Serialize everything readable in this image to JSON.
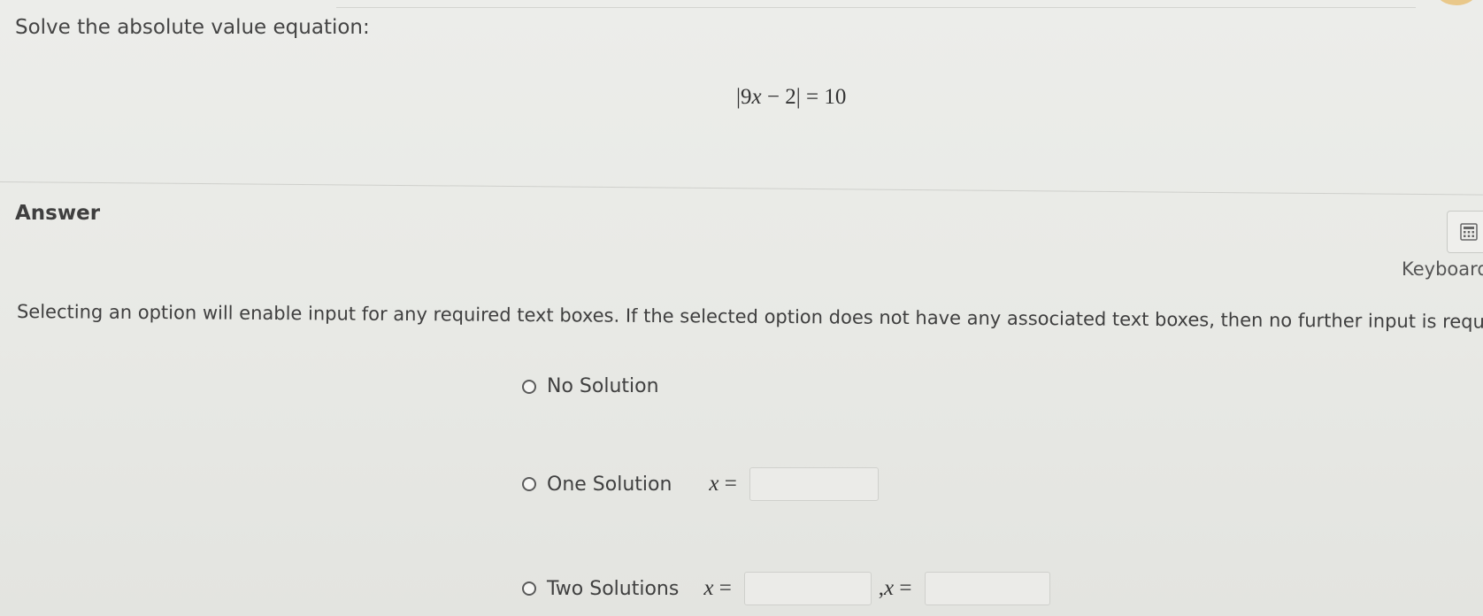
{
  "prompt": "Solve the absolute value equation:",
  "equation": {
    "bar_open": "|",
    "coef": "9",
    "variable": "x",
    "minus": " − 2",
    "bar_close": "|",
    "equals": " = ",
    "rhs": "10"
  },
  "answer_heading": "Answer",
  "keyboard": {
    "icon": "calculator-icon",
    "label": "Keyboard"
  },
  "instructions": "Selecting an option will enable input for any required text boxes. If the selected option does not have any associated text boxes, then no further input is required.",
  "options": [
    {
      "label": "No Solution"
    },
    {
      "label": "One Solution",
      "prefix_var": "x",
      "prefix_eq": " =",
      "value": ""
    },
    {
      "label": "Two Solutions",
      "prefix_var": "x",
      "prefix_eq": " =",
      "value_1": "",
      "separator": ",",
      "second_var": "x",
      "second_eq": " =",
      "value_2": ""
    }
  ]
}
